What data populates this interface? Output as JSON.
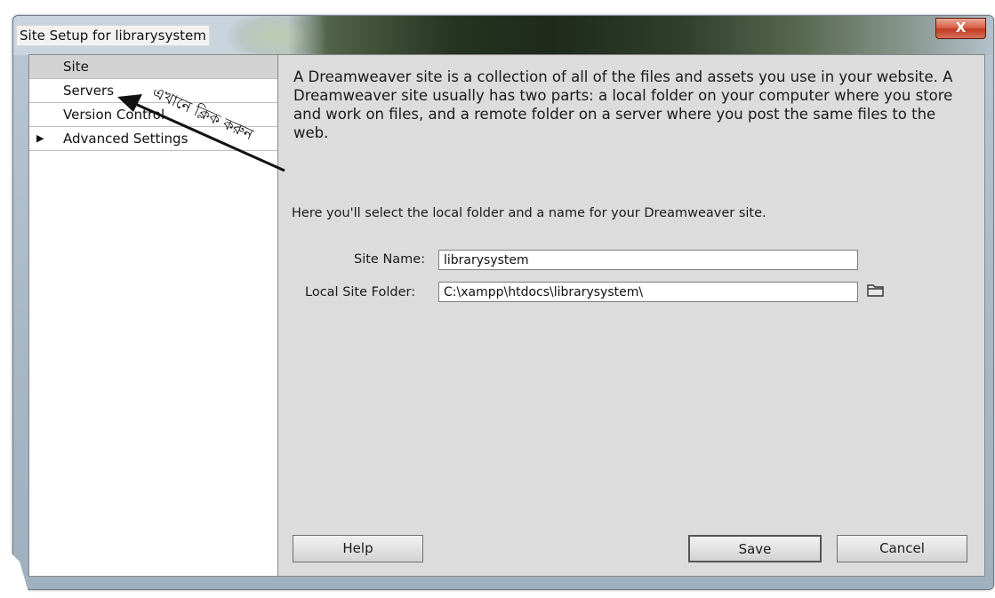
{
  "window": {
    "title": "Site Setup for librarysystem",
    "close_glyph": "X"
  },
  "nav": {
    "items": [
      {
        "label": "Site",
        "selected": true,
        "has_arrow": false
      },
      {
        "label": "Servers",
        "selected": false,
        "has_arrow": false
      },
      {
        "label": "Version Control",
        "selected": false,
        "has_arrow": false
      },
      {
        "label": "Advanced Settings",
        "selected": false,
        "has_arrow": true,
        "arrow_glyph": "▶"
      }
    ]
  },
  "annotation": {
    "text": "এখানে ক্লিক করুন"
  },
  "main": {
    "description": "A Dreamweaver site is a collection of all of the files and assets you use in your website. A Dreamweaver site usually has two parts: a local folder on your computer where you store and work on files, and a remote folder on a server where you post the same files to the web.",
    "intro": "Here you'll select the local folder and a name for your Dreamweaver site.",
    "site_name_label": "Site Name:",
    "site_name_value": "librarysystem",
    "local_folder_label": "Local Site Folder:",
    "local_folder_value": "C:\\xampp\\htdocs\\librarysystem\\",
    "folder_icon": "folder-icon"
  },
  "buttons": {
    "help": "Help",
    "save": "Save",
    "cancel": "Cancel"
  },
  "colors": {
    "close_button": "#c9462c",
    "dialog_bg": "#dcdcdc",
    "selected_nav": "#d3d3d3"
  }
}
